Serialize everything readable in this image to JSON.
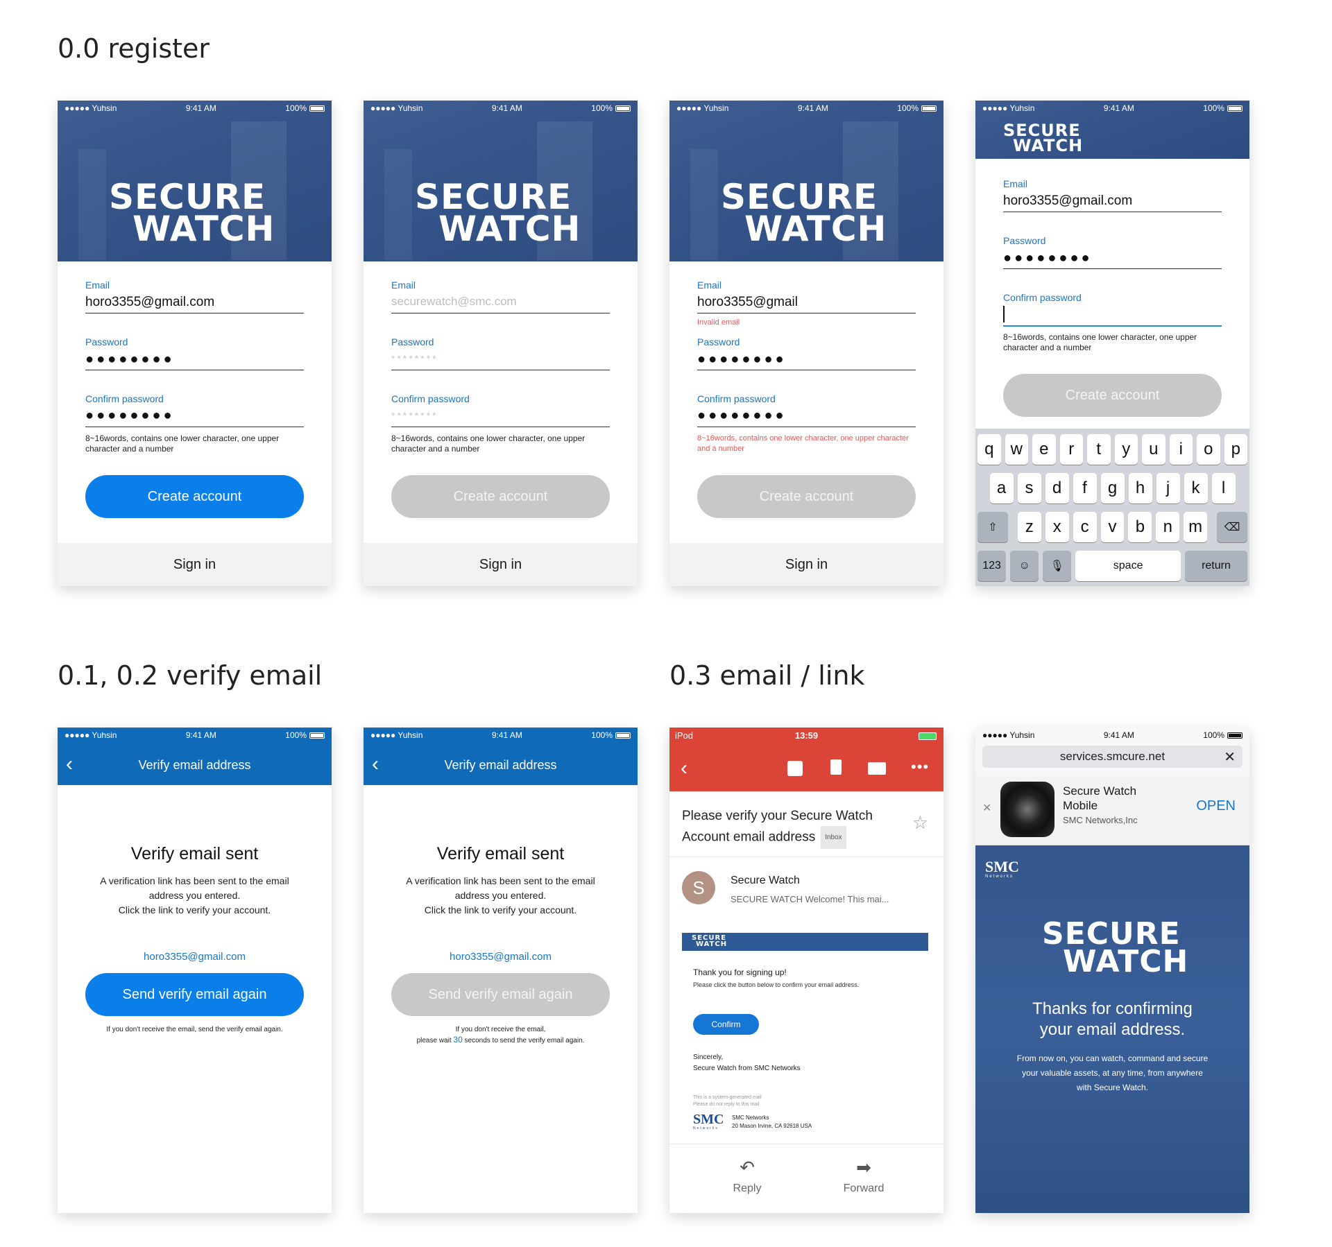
{
  "sections": {
    "register": "0.0 register",
    "verify": "0.1, 0.2 verify email",
    "email_link": "0.3 email / link"
  },
  "status": {
    "carrier": "●●●●● Yuhsin",
    "time": "9:41 AM",
    "battery": "100%"
  },
  "logo": {
    "line1": "SECURE",
    "line2": "WATCH"
  },
  "register_screens": [
    {
      "email_label": "Email",
      "email_value": "horo3355@gmail.com",
      "password_label": "Password",
      "password_value": "●●●●●●●●",
      "confirm_label": "Confirm password",
      "confirm_value": "●●●●●●●●",
      "hint": "8~16words, contains one lower character, one upper character and a number",
      "button": "Create account",
      "signin": "Sign in"
    },
    {
      "email_label": "Email",
      "email_placeholder": "securewatch@smc.com",
      "password_label": "Password",
      "password_placeholder": "********",
      "confirm_label": "Confirm password",
      "confirm_placeholder": "********",
      "hint": "8~16words, contains one lower character, one upper character and a number",
      "button": "Create account",
      "signin": "Sign in"
    },
    {
      "email_label": "Email",
      "email_value": "horo3355@gmail",
      "email_error": "Invalid email",
      "password_label": "Password",
      "password_value": "●●●●●●●●",
      "confirm_label": "Confirm password",
      "confirm_value": "●●●●●●●●",
      "hint": "8~16words, contains one lower character, one upper character and a number",
      "button": "Create account",
      "signin": "Sign in"
    },
    {
      "email_label": "Email",
      "email_value": "horo3355@gmail.com",
      "password_label": "Password",
      "password_value": "●●●●●●●●",
      "confirm_label": "Confirm password",
      "hint": "8~16words, contains one lower character, one upper character and a number",
      "button": "Create account"
    }
  ],
  "keyboard": {
    "row1": [
      "q",
      "w",
      "e",
      "r",
      "t",
      "y",
      "u",
      "i",
      "o",
      "p"
    ],
    "row2": [
      "a",
      "s",
      "d",
      "f",
      "g",
      "h",
      "j",
      "k",
      "l"
    ],
    "row3": [
      "z",
      "x",
      "c",
      "v",
      "b",
      "n",
      "m"
    ],
    "numbers": "123",
    "space": "space",
    "return": "return"
  },
  "verify_screens": [
    {
      "nav_title": "Verify email address",
      "title": "Verify email sent",
      "line1": "A verification link has been sent to the email",
      "line2": "address you entered.",
      "line3": "Click the link to verify your account.",
      "email": "horo3355@gmail.com",
      "button": "Send verify email again",
      "note": "If you don't receive the email, send the verify email again."
    },
    {
      "nav_title": "Verify email address",
      "title": "Verify email sent",
      "line1": "A verification link has been sent to the email",
      "line2": "address you entered.",
      "line3": "Click the link to verify your account.",
      "email": "horo3355@gmail.com",
      "button": "Send verify email again",
      "note_a": "If you don't receive the email,",
      "note_b": "please wait",
      "note_num": "30",
      "note_c": "seconds to send the verify email again."
    }
  ],
  "gmail": {
    "device": "iPod",
    "time": "13:59",
    "subject_1": "Please verify your Secure Watch",
    "subject_2": "Account email address",
    "label": "Inbox",
    "avatar": "S",
    "sender": "Secure Watch",
    "preview": "SECURE WATCH Welcome! This mai...",
    "band_logo_1": "SECURE",
    "band_logo_2": "WATCH",
    "thanks": "Thank you for signing up!",
    "instruction": "Please click the button below to confirm your email address.",
    "confirm": "Confirm",
    "sincerely": "Sincerely,",
    "signature": "Secure Watch from SMC Networks",
    "sys1": "This is a system-generated mail",
    "sys2": "Please do not reply to this mail",
    "smc": "SMC",
    "smc_sub": "Networks",
    "addr1": "SMC Networks",
    "addr2": "20 Mason Irvine, CA 92618 USA",
    "reply": "Reply",
    "forward": "Forward"
  },
  "safari": {
    "url": "services.smcure.net",
    "app_name_1": "Secure Watch",
    "app_name_2": "Mobile",
    "publisher": "SMC Networks,Inc",
    "open": "OPEN",
    "smc": "SMC",
    "smc_sub": "Networks",
    "thanks_1": "Thanks for confirming",
    "thanks_2": "your email address.",
    "body_1": "From now on, you can watch, command and secure",
    "body_2": "your valuable assets, at any time, from anywhere",
    "body_3": "with Secure Watch."
  },
  "colors": {
    "primary": "#0b7fe9",
    "nav": "#0f6ab8",
    "gmail": "#dc4437",
    "error": "#e25a5a",
    "hero": "#35558a"
  }
}
